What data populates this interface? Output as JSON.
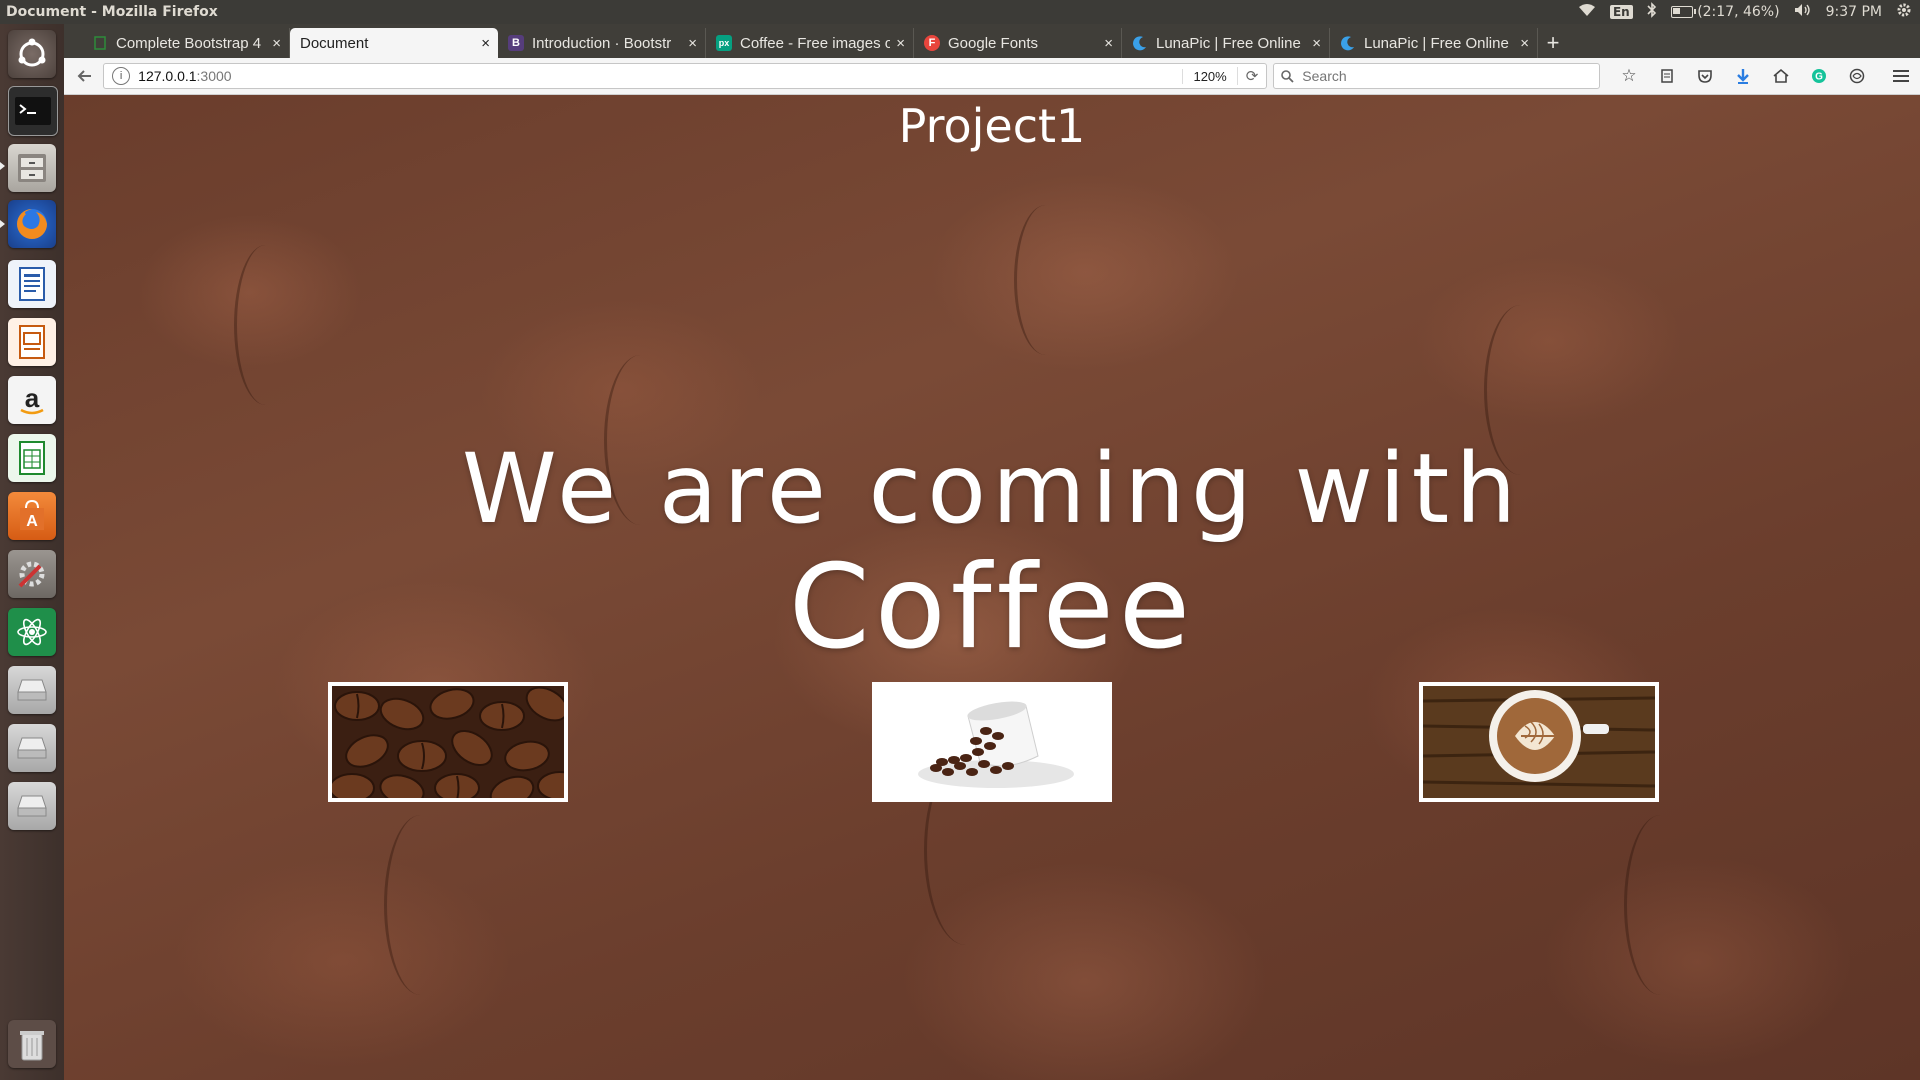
{
  "system": {
    "window_title": "Document - Mozilla Firefox",
    "keyboard": "En",
    "battery": "(2:17, 46%)",
    "clock": "9:37 PM"
  },
  "tabs": [
    {
      "label": "Complete Bootstrap 4",
      "favicon": "doc-icon",
      "active": false
    },
    {
      "label": "Document",
      "favicon": "",
      "active": true
    },
    {
      "label": "Introduction · Bootstr",
      "favicon": "bootstrap-icon",
      "active": false
    },
    {
      "label": "Coffee - Free images o",
      "favicon": "pexels-icon",
      "active": false
    },
    {
      "label": "Google Fonts",
      "favicon": "google-fonts-icon",
      "active": false
    },
    {
      "label": "LunaPic | Free Online F",
      "favicon": "lunapic-icon",
      "active": false
    },
    {
      "label": "LunaPic | Free Online F",
      "favicon": "lunapic-icon",
      "active": false
    }
  ],
  "navbar": {
    "url_host": "127.0.0.1",
    "url_port": ":3000",
    "zoom": "120%",
    "search_placeholder": "Search"
  },
  "page": {
    "project_title": "Project1",
    "hero_line1": "We are coming with",
    "hero_line2": "Coffee"
  },
  "colors": {
    "panel": "#3c3b37",
    "tab_bg": "#403e39",
    "page_bg": "#6a3d2c"
  }
}
